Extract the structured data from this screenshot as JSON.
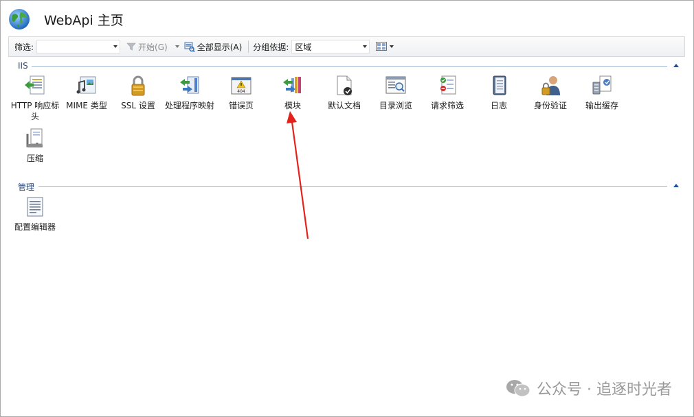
{
  "header": {
    "title": "WebApi 主页",
    "icon": "globe-icon"
  },
  "toolbar": {
    "filter_label": "筛选:",
    "filter_value": "",
    "start_label": "开始(G)",
    "show_all_label": "全部显示(A)",
    "group_by_label": "分组依据:",
    "group_by_value": "区域"
  },
  "sections": [
    {
      "title": "IIS",
      "items": [
        {
          "label": "HTTP 响应标头",
          "icon": "http-response-headers-icon"
        },
        {
          "label": "MIME 类型",
          "icon": "mime-types-icon"
        },
        {
          "label": "SSL 设置",
          "icon": "ssl-lock-icon"
        },
        {
          "label": "处理程序映射",
          "icon": "handler-mappings-icon"
        },
        {
          "label": "错误页",
          "icon": "error-pages-icon"
        },
        {
          "label": "模块",
          "icon": "modules-icon"
        },
        {
          "label": "默认文档",
          "icon": "default-document-icon"
        },
        {
          "label": "目录浏览",
          "icon": "directory-browsing-icon"
        },
        {
          "label": "请求筛选",
          "icon": "request-filtering-icon"
        },
        {
          "label": "日志",
          "icon": "logging-icon"
        },
        {
          "label": "身份验证",
          "icon": "authentication-icon"
        },
        {
          "label": "输出缓存",
          "icon": "output-caching-icon"
        },
        {
          "label": "压缩",
          "icon": "compression-icon"
        }
      ]
    },
    {
      "title": "管理",
      "items": [
        {
          "label": "配置编辑器",
          "icon": "configuration-editor-icon"
        }
      ]
    }
  ],
  "watermark": {
    "text": "公众号 · 追逐时光者",
    "icon": "wechat-icon"
  },
  "colors": {
    "section_text": "#2b4a7e",
    "section_line": "#9fb4d3",
    "annotation_arrow": "#e3231b"
  }
}
